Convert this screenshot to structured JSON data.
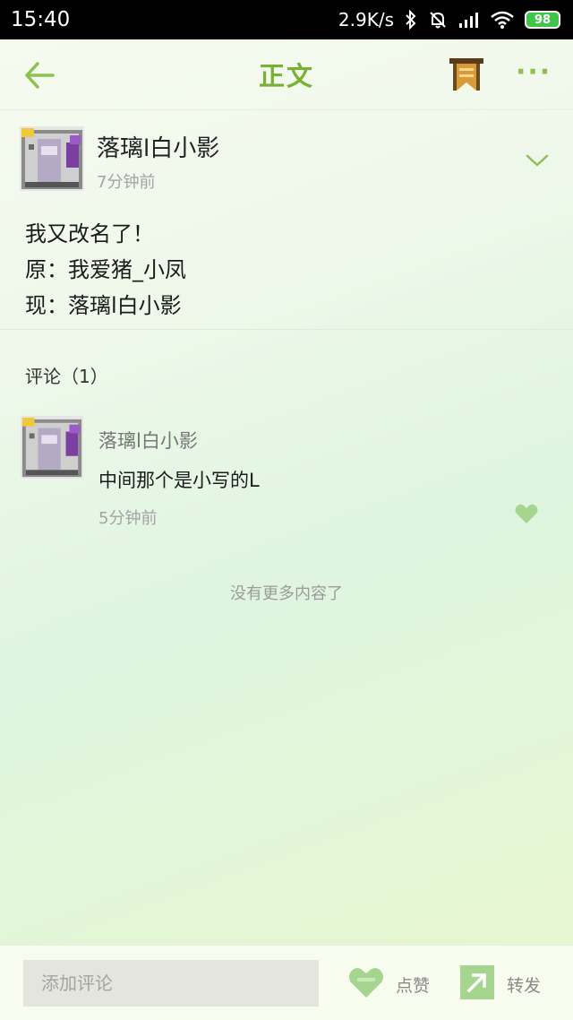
{
  "status_bar": {
    "time": "15:40",
    "net_speed": "2.9K/s",
    "battery": "98",
    "icons": [
      "bluetooth-icon",
      "mute-bell-icon",
      "signal-icon",
      "wifi-icon",
      "battery-icon"
    ]
  },
  "header": {
    "title": "正文",
    "icons": [
      "back-arrow-icon",
      "bookmark-banner-icon",
      "more-icon"
    ]
  },
  "post": {
    "author": "落璃l白小影",
    "time": "7分钟前",
    "lines": [
      "我又改名了！",
      "原：我爱猪_小凤",
      "现：落璃l白小影"
    ]
  },
  "comments": {
    "header": "评论（1）",
    "items": [
      {
        "author": "落璃l白小影",
        "text": "中间那个是小写的L",
        "time": "5分钟前"
      }
    ]
  },
  "footer_note": "没有更多内容了",
  "bottom_bar": {
    "comment_placeholder": "添加评论",
    "like_label": "点赞",
    "share_label": "转发"
  },
  "colors": {
    "accent": "#79b136",
    "icon_green": "#8cc150",
    "like_green": "#a5d58f"
  }
}
